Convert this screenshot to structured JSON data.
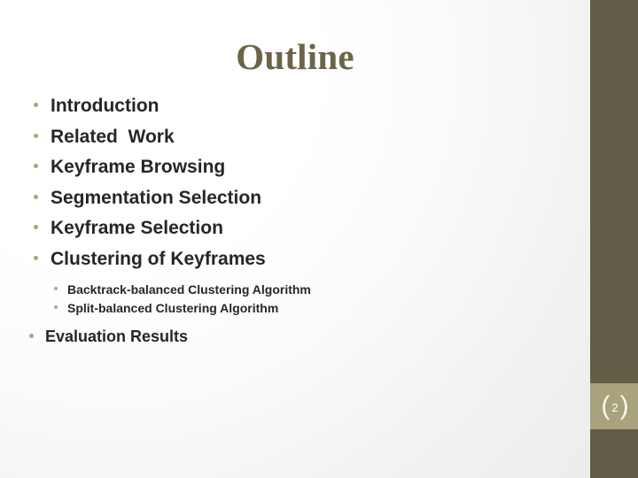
{
  "slide": {
    "title": "Outline",
    "page_number": "2",
    "bracket_left": "(",
    "bracket_right": ")",
    "colors": {
      "title": "#6b6449",
      "sidebar": "#635c46",
      "page_plate": "#a8a37c",
      "bullet_level1": "#a9a47c",
      "bullet_level2": "#9aaeb0",
      "body_text": "#262626",
      "background": "#ffffff"
    },
    "outline": [
      {
        "level": 1,
        "label": "Introduction"
      },
      {
        "level": 1,
        "label": "Related  Work"
      },
      {
        "level": 1,
        "label": "Keyframe Browsing"
      },
      {
        "level": 1,
        "label": "Segmentation Selection"
      },
      {
        "level": 1,
        "label": "Keyframe Selection"
      },
      {
        "level": 1,
        "label": "Clustering of Keyframes"
      },
      {
        "level": 2,
        "label": "Backtrack-balanced Clustering Algorithm"
      },
      {
        "level": 2,
        "label": "Split-balanced Clustering Algorithm"
      },
      {
        "level": 3,
        "label": "Evaluation Results"
      }
    ]
  }
}
